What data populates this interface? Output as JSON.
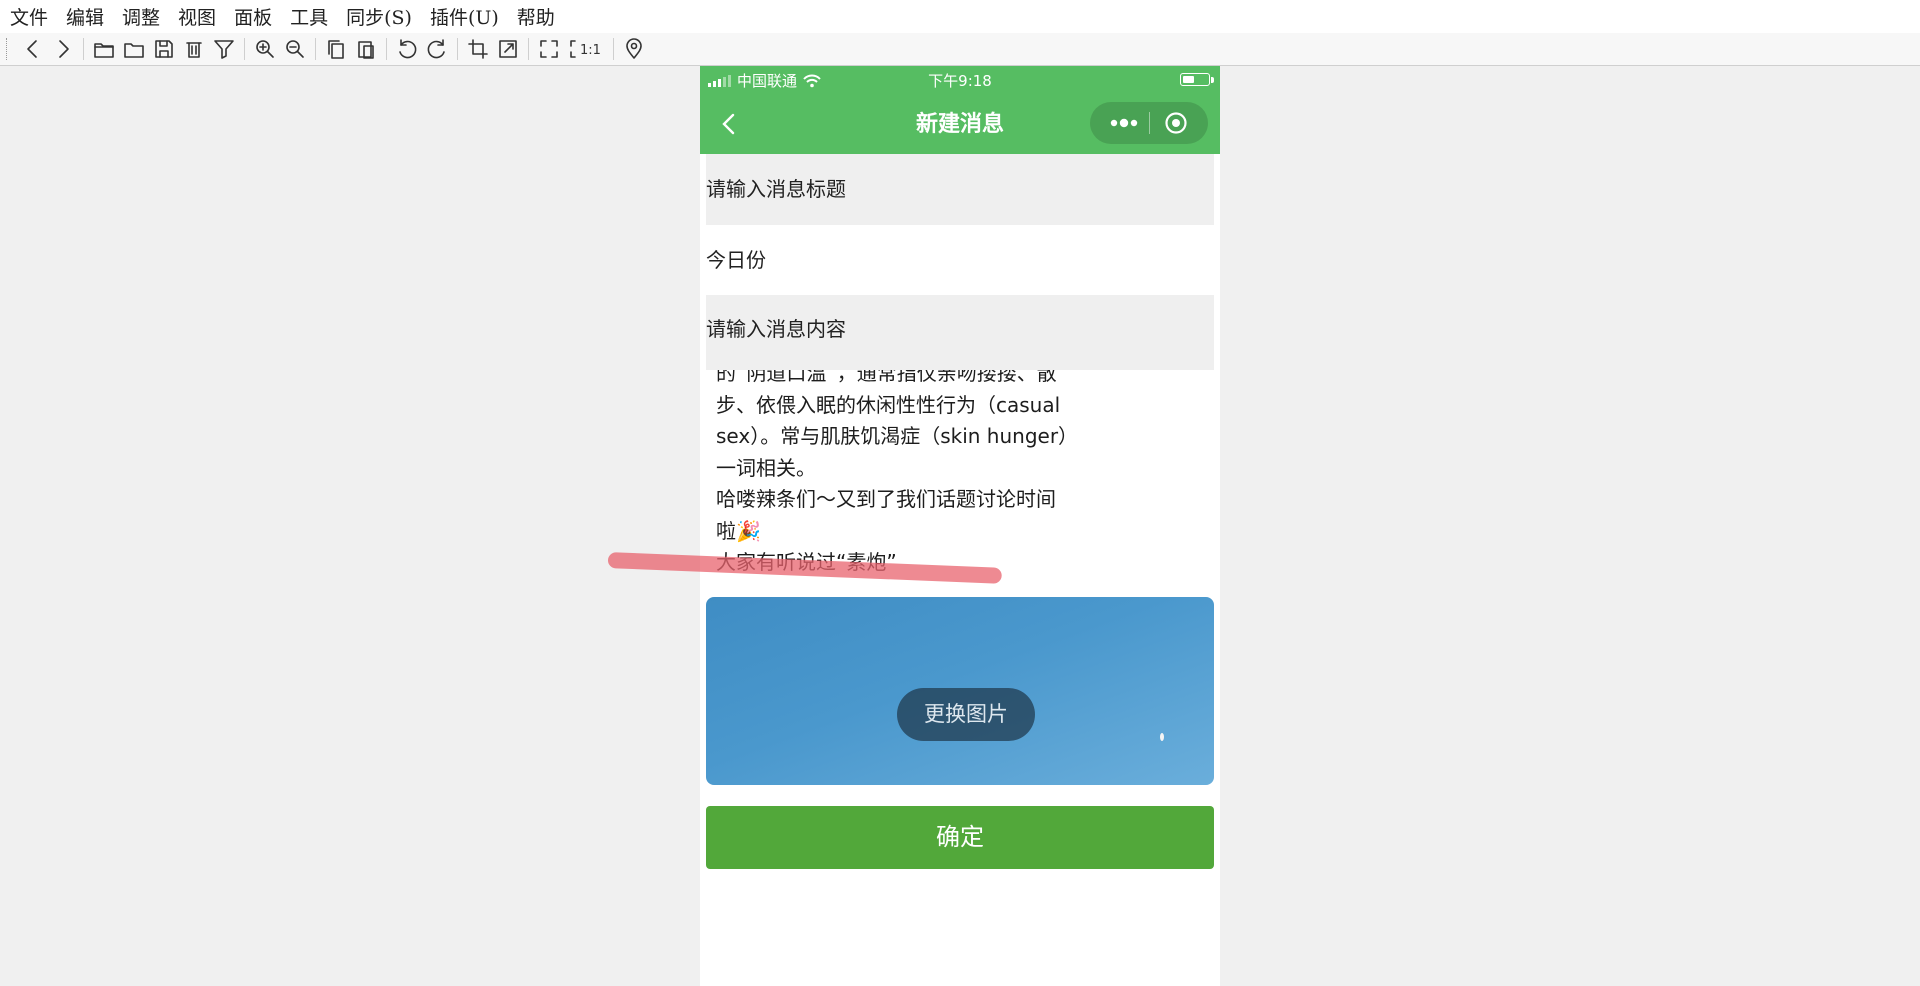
{
  "menubar": {
    "items": [
      "文件",
      "编辑",
      "调整",
      "视图",
      "面板",
      "工具",
      "同步(S)",
      "插件(U)",
      "帮助"
    ]
  },
  "toolbar": {
    "icons": [
      "back-icon",
      "forward-icon",
      "open-folder-icon",
      "folder-icon",
      "save-icon",
      "delete-icon",
      "filter-icon",
      "zoom-in-icon",
      "zoom-out-icon",
      "copy-icon",
      "paste-icon",
      "rotate-left-icon",
      "rotate-right-icon",
      "crop-icon",
      "resize-icon",
      "fit-screen-icon",
      "actual-size-icon",
      "location-icon"
    ],
    "actual_size_label": "1:1"
  },
  "phone": {
    "carrier": "中国联通",
    "time": "下午9:18",
    "battery_level": 0.45,
    "nav_title": "新建消息",
    "title_placeholder": "请输入消息标题",
    "date_value": "今日份",
    "content_placeholder": "请输入消息内容",
    "body_text": "的“阴道口温”，通常指仅亲吻搂搂、散\n步、依偎入眠的休闲性性行为（casual\nsex）。常与肌肤饥渴症（skin hunger）\n一词相关。\n哈喽辣条们～又到了我们话题讨论时间\n啦🎉\n大家有听说过“素炮”",
    "change_image_label": "更换图片",
    "confirm_label": "确定"
  },
  "colors": {
    "green_header": "#56bd62",
    "confirm_green": "#52a83a",
    "highlight_red": "#e8636e",
    "sky_blue": "#4a98cd"
  }
}
